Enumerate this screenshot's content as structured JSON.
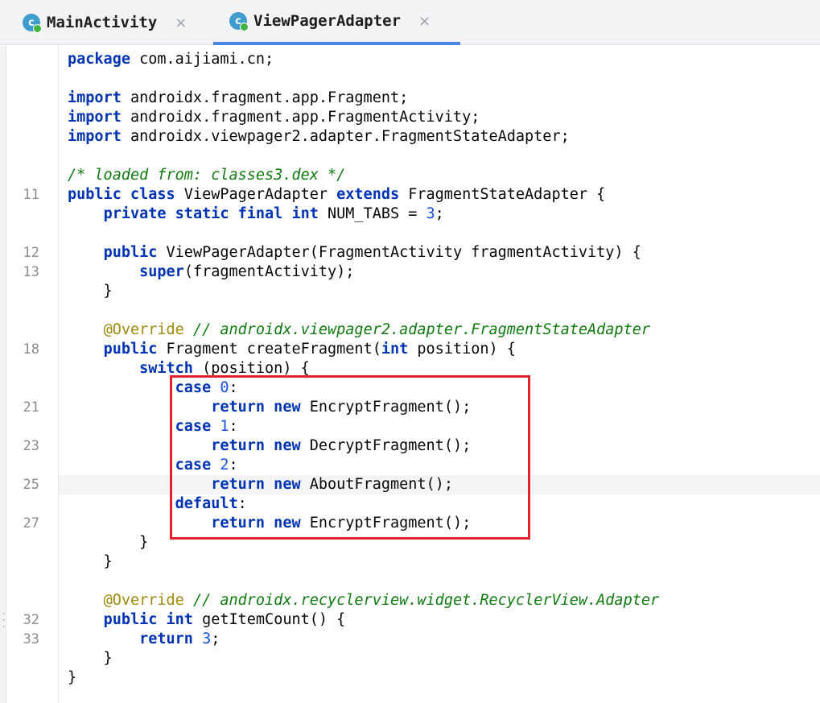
{
  "tabs": [
    {
      "label": "MainActivity",
      "icon": "class-icon",
      "close": "×",
      "active": false
    },
    {
      "label": "ViewPagerAdapter",
      "icon": "class-icon",
      "close": "×",
      "active": true
    }
  ],
  "icon_letter": "c",
  "gutter_numbers": [
    "11",
    "12",
    "13",
    "18",
    "21",
    "23",
    "25",
    "27",
    "32",
    "33"
  ],
  "code": {
    "l1": {
      "kw": "package",
      "rest": " com.aijiami.cn;"
    },
    "l3": {
      "kw": "import",
      "rest": " androidx.fragment.app.Fragment;"
    },
    "l4": {
      "kw": "import",
      "rest": " androidx.fragment.app.FragmentActivity;"
    },
    "l5": {
      "kw": "import",
      "rest": " androidx.viewpager2.adapter.FragmentStateAdapter;"
    },
    "l7": {
      "comment": "/* loaded from: classes3.dex */"
    },
    "l8": {
      "kw1": "public class",
      "name": " ViewPagerAdapter ",
      "kw2": "extends",
      "rest": " FragmentStateAdapter {"
    },
    "l9": {
      "indent": "    ",
      "kw": "private static final int",
      "rest": " NUM_TABS = ",
      "num": "3",
      "end": ";"
    },
    "l11": {
      "indent": "    ",
      "kw": "public",
      "rest": " ViewPagerAdapter(FragmentActivity fragmentActivity) {"
    },
    "l12": {
      "indent": "        ",
      "kw": "super",
      "rest": "(fragmentActivity);"
    },
    "l13": {
      "text": "    }"
    },
    "l15": {
      "indent": "    ",
      "ann": "@Override",
      "comment": " // androidx.viewpager2.adapter.FragmentStateAdapter"
    },
    "l16": {
      "indent": "    ",
      "kw": "public",
      "rest": " Fragment createFragment(",
      "kw2": "int",
      "rest2": " position) {"
    },
    "l17": {
      "indent": "        ",
      "kw": "switch",
      "rest": " (position) {"
    },
    "l18": {
      "indent": "            ",
      "kw": "case",
      "sp": " ",
      "num": "0",
      "end": ":"
    },
    "l19": {
      "indent": "                ",
      "kw": "return new",
      "rest": " EncryptFragment();"
    },
    "l20": {
      "indent": "            ",
      "kw": "case",
      "sp": " ",
      "num": "1",
      "end": ":"
    },
    "l21": {
      "indent": "                ",
      "kw": "return new",
      "rest": " DecryptFragment();"
    },
    "l22": {
      "indent": "            ",
      "kw": "case",
      "sp": " ",
      "num": "2",
      "end": ":"
    },
    "l23": {
      "indent": "                ",
      "kw": "return new",
      "rest": " AboutFragment();"
    },
    "l24": {
      "indent": "            ",
      "kw": "default",
      "end": ":"
    },
    "l25": {
      "indent": "                ",
      "kw": "return new",
      "rest": " EncryptFragment();"
    },
    "l26": {
      "text": "        }"
    },
    "l27": {
      "text": "    }"
    },
    "l29": {
      "indent": "    ",
      "ann": "@Override",
      "comment": " // androidx.recyclerview.widget.RecyclerView.Adapter"
    },
    "l30": {
      "indent": "    ",
      "kw": "public int",
      "rest": " getItemCount() {"
    },
    "l31": {
      "indent": "        ",
      "kw": "return",
      "sp": " ",
      "num": "3",
      "end": ";"
    },
    "l32": {
      "text": "    }"
    },
    "l33": {
      "text": "}"
    }
  },
  "colors": {
    "keyword": "#0033b3",
    "number": "#1750eb",
    "comment": "#0f7a0f",
    "annotation": "#9e880d",
    "highlight_box": "#e0242e",
    "tab_underline": "#4a86e8"
  }
}
